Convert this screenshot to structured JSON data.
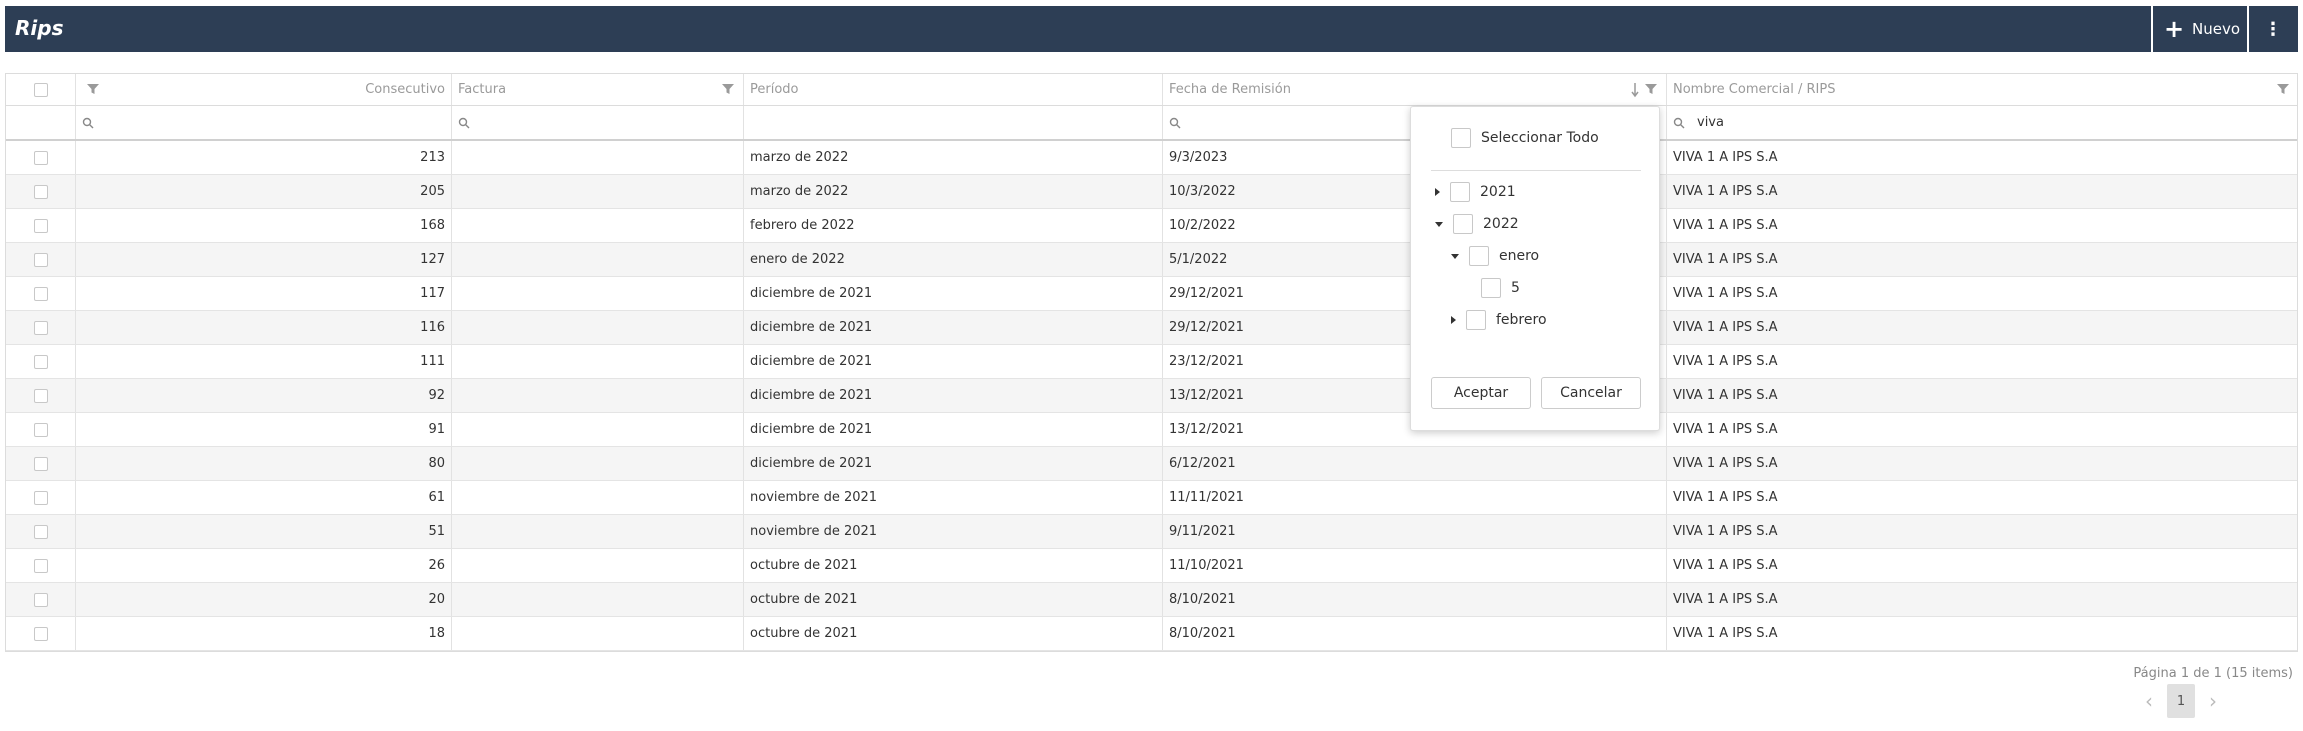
{
  "header": {
    "title": "Rips",
    "new_label": "Nuevo"
  },
  "columns": [
    "Consecutivo",
    "Factura",
    "Período",
    "Fecha de Remisión",
    "Nombre Comercial / RIPS"
  ],
  "filters": {
    "name_filter_value": "viva"
  },
  "rows": [
    {
      "consecutivo": "213",
      "factura": "",
      "periodo": "marzo de 2022",
      "fecha": "9/3/2023",
      "nombre": "VIVA 1 A IPS S.A"
    },
    {
      "consecutivo": "205",
      "factura": "",
      "periodo": "marzo de 2022",
      "fecha": "10/3/2022",
      "nombre": "VIVA 1 A IPS S.A"
    },
    {
      "consecutivo": "168",
      "factura": "",
      "periodo": "febrero de 2022",
      "fecha": "10/2/2022",
      "nombre": "VIVA 1 A IPS S.A"
    },
    {
      "consecutivo": "127",
      "factura": "",
      "periodo": "enero de 2022",
      "fecha": "5/1/2022",
      "nombre": "VIVA 1 A IPS S.A"
    },
    {
      "consecutivo": "117",
      "factura": "",
      "periodo": "diciembre de 2021",
      "fecha": "29/12/2021",
      "nombre": "VIVA 1 A IPS S.A"
    },
    {
      "consecutivo": "116",
      "factura": "",
      "periodo": "diciembre de 2021",
      "fecha": "29/12/2021",
      "nombre": "VIVA 1 A IPS S.A"
    },
    {
      "consecutivo": "111",
      "factura": "",
      "periodo": "diciembre de 2021",
      "fecha": "23/12/2021",
      "nombre": "VIVA 1 A IPS S.A"
    },
    {
      "consecutivo": "92",
      "factura": "",
      "periodo": "diciembre de 2021",
      "fecha": "13/12/2021",
      "nombre": "VIVA 1 A IPS S.A"
    },
    {
      "consecutivo": "91",
      "factura": "",
      "periodo": "diciembre de 2021",
      "fecha": "13/12/2021",
      "nombre": "VIVA 1 A IPS S.A"
    },
    {
      "consecutivo": "80",
      "factura": "",
      "periodo": "diciembre de 2021",
      "fecha": "6/12/2021",
      "nombre": "VIVA 1 A IPS S.A"
    },
    {
      "consecutivo": "61",
      "factura": "",
      "periodo": "noviembre de 2021",
      "fecha": "11/11/2021",
      "nombre": "VIVA 1 A IPS S.A"
    },
    {
      "consecutivo": "51",
      "factura": "",
      "periodo": "noviembre de 2021",
      "fecha": "9/11/2021",
      "nombre": "VIVA 1 A IPS S.A"
    },
    {
      "consecutivo": "26",
      "factura": "",
      "periodo": "octubre de 2021",
      "fecha": "11/10/2021",
      "nombre": "VIVA 1 A IPS S.A"
    },
    {
      "consecutivo": "20",
      "factura": "",
      "periodo": "octubre de 2021",
      "fecha": "8/10/2021",
      "nombre": "VIVA 1 A IPS S.A"
    },
    {
      "consecutivo": "18",
      "factura": "",
      "periodo": "octubre de 2021",
      "fecha": "8/10/2021",
      "nombre": "VIVA 1 A IPS S.A"
    }
  ],
  "dropdown": {
    "select_all": "Seleccionar Todo",
    "year_2021": "2021",
    "year_2022": "2022",
    "month_enero": "enero",
    "day_5": "5",
    "month_febrero": "febrero",
    "accept": "Aceptar",
    "cancel": "Cancelar"
  },
  "pager": {
    "info": "Página 1 de 1 (15 items)",
    "current_page": "1"
  }
}
